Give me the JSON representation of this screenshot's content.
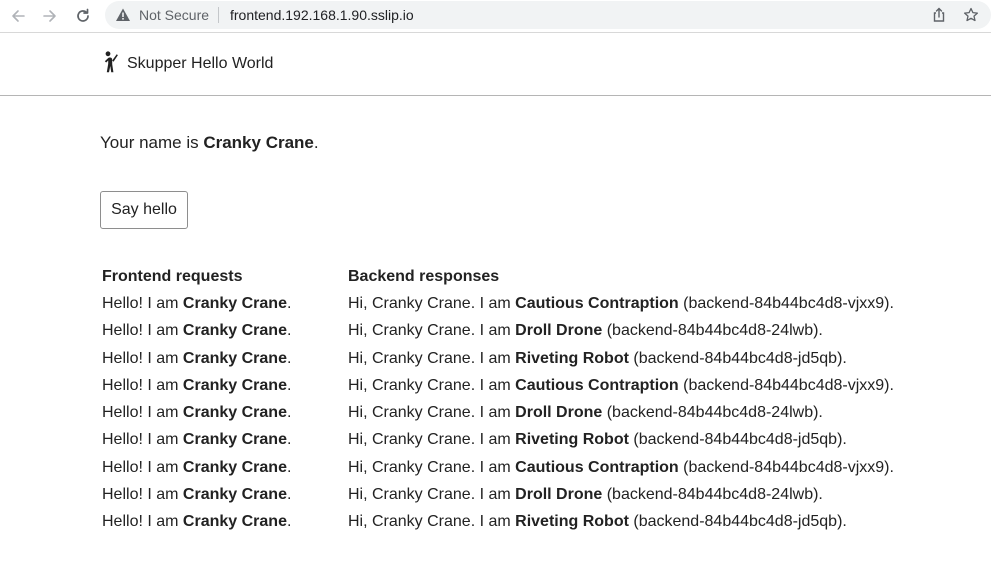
{
  "browser": {
    "security_label": "Not Secure",
    "url": "frontend.192.168.1.90.sslip.io"
  },
  "header": {
    "title": "Skupper Hello World",
    "icon": "person-walking-icon"
  },
  "main": {
    "name_prefix": "Your name is ",
    "name": "Cranky Crane",
    "name_suffix": ".",
    "say_hello_label": "Say hello"
  },
  "table": {
    "frontend_header": "Frontend requests",
    "backend_header": "Backend responses",
    "rows": [
      {
        "front_prefix": "Hello! I am ",
        "front_name": "Cranky Crane",
        "front_suffix": ".",
        "back_prefix": "Hi, Cranky Crane. I am ",
        "back_name": "Cautious Contraption",
        "back_suffix": " (backend-84b44bc4d8-vjxx9)."
      },
      {
        "front_prefix": "Hello! I am ",
        "front_name": "Cranky Crane",
        "front_suffix": ".",
        "back_prefix": "Hi, Cranky Crane. I am ",
        "back_name": "Droll Drone",
        "back_suffix": " (backend-84b44bc4d8-24lwb)."
      },
      {
        "front_prefix": "Hello! I am ",
        "front_name": "Cranky Crane",
        "front_suffix": ".",
        "back_prefix": "Hi, Cranky Crane. I am ",
        "back_name": "Riveting Robot",
        "back_suffix": " (backend-84b44bc4d8-jd5qb)."
      },
      {
        "front_prefix": "Hello! I am ",
        "front_name": "Cranky Crane",
        "front_suffix": ".",
        "back_prefix": "Hi, Cranky Crane. I am ",
        "back_name": "Cautious Contraption",
        "back_suffix": " (backend-84b44bc4d8-vjxx9)."
      },
      {
        "front_prefix": "Hello! I am ",
        "front_name": "Cranky Crane",
        "front_suffix": ".",
        "back_prefix": "Hi, Cranky Crane. I am ",
        "back_name": "Droll Drone",
        "back_suffix": " (backend-84b44bc4d8-24lwb)."
      },
      {
        "front_prefix": "Hello! I am ",
        "front_name": "Cranky Crane",
        "front_suffix": ".",
        "back_prefix": "Hi, Cranky Crane. I am ",
        "back_name": "Riveting Robot",
        "back_suffix": " (backend-84b44bc4d8-jd5qb)."
      },
      {
        "front_prefix": "Hello! I am ",
        "front_name": "Cranky Crane",
        "front_suffix": ".",
        "back_prefix": "Hi, Cranky Crane. I am ",
        "back_name": "Cautious Contraption",
        "back_suffix": " (backend-84b44bc4d8-vjxx9)."
      },
      {
        "front_prefix": "Hello! I am ",
        "front_name": "Cranky Crane",
        "front_suffix": ".",
        "back_prefix": "Hi, Cranky Crane. I am ",
        "back_name": "Droll Drone",
        "back_suffix": " (backend-84b44bc4d8-24lwb)."
      },
      {
        "front_prefix": "Hello! I am ",
        "front_name": "Cranky Crane",
        "front_suffix": ".",
        "back_prefix": "Hi, Cranky Crane. I am ",
        "back_name": "Riveting Robot",
        "back_suffix": " (backend-84b44bc4d8-jd5qb)."
      }
    ]
  }
}
